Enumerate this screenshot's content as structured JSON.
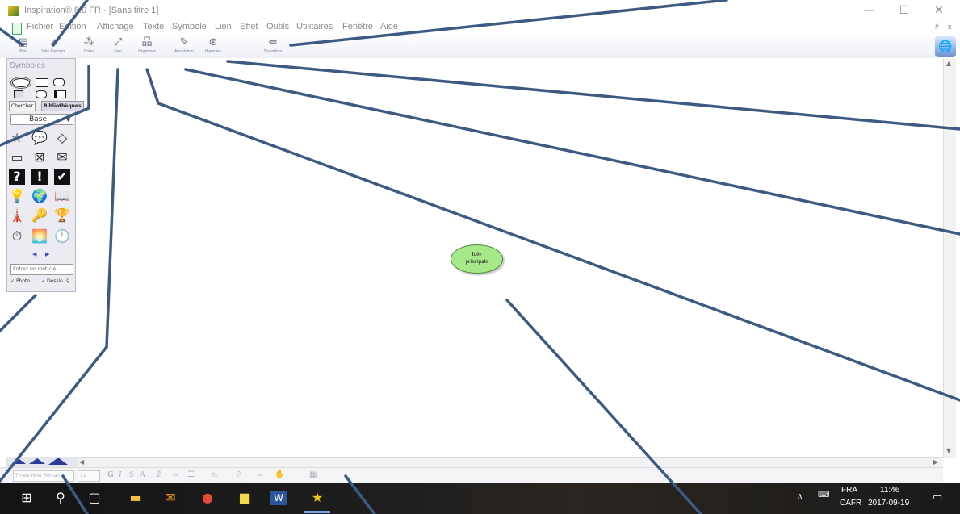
{
  "window": {
    "title": "Inspiration® 8.0 FR - [Sans titre 1]",
    "controls": {
      "minimize": "—",
      "maximize": "☐",
      "close": "✕"
    },
    "doc_controls": {
      "minimize": "-",
      "restore": "#",
      "close": "x"
    }
  },
  "menu": {
    "items": [
      "Fichier",
      "Edition",
      "Affichage",
      "Texte",
      "Symbole",
      "Lien",
      "Effet",
      "Outils",
      "Utilitaires",
      "Fenêtre",
      "Aide"
    ]
  },
  "toolbar": {
    "buttons": [
      {
        "label": "Plan",
        "icon": "outline-view-icon",
        "glyph": "▤"
      },
      {
        "label": "Idée Express",
        "icon": "rapidfire-icon",
        "glyph": "➚"
      },
      {
        "label": "Créer",
        "icon": "create-icon",
        "glyph": "⁂"
      },
      {
        "label": "Lien",
        "icon": "link-icon",
        "glyph": "⤢"
      },
      {
        "label": "Organiser",
        "icon": "arrange-icon",
        "glyph": "品"
      },
      {
        "label": "Annotation",
        "icon": "note-icon",
        "glyph": "✎"
      },
      {
        "label": "Hyperlien",
        "icon": "hyperlink-icon",
        "glyph": "⊛"
      },
      {
        "label": "Transférer",
        "icon": "transfer-icon",
        "glyph": "⇚"
      }
    ]
  },
  "palette": {
    "title": "Symboles",
    "tabs": {
      "search": "Chercher",
      "libraries": "Bibliothèques"
    },
    "library_selected": "Base",
    "search_placeholder": "Entrez un mot-clé...",
    "photo_label": "Photo",
    "drawing_label": "Dessin",
    "symbols": [
      {
        "icon": "star-shape-icon",
        "glyph": "☆"
      },
      {
        "icon": "speech-bubble-icon",
        "glyph": "💬"
      },
      {
        "icon": "diamond-shape-icon",
        "glyph": "◇"
      },
      {
        "icon": "rectangle-shape-icon",
        "glyph": "▭"
      },
      {
        "icon": "crossed-box-icon",
        "glyph": "⊠"
      },
      {
        "icon": "envelope-icon",
        "glyph": "✉"
      },
      {
        "icon": "question-mark-icon",
        "glyph": "?"
      },
      {
        "icon": "exclamation-icon",
        "glyph": "!"
      },
      {
        "icon": "checkmark-icon",
        "glyph": "✔"
      },
      {
        "icon": "lightbulb-icon",
        "glyph": "💡"
      },
      {
        "icon": "earth-icon",
        "glyph": "🌍"
      },
      {
        "icon": "book-icon",
        "glyph": "📖"
      },
      {
        "icon": "lighthouse-icon",
        "glyph": "🗼"
      },
      {
        "icon": "key-icon",
        "glyph": "🔑"
      },
      {
        "icon": "trophy-icon",
        "glyph": "🏆"
      },
      {
        "icon": "stopwatch-icon",
        "glyph": "⏱"
      },
      {
        "icon": "sunset-icon",
        "glyph": "🌅"
      },
      {
        "icon": "clock-icon",
        "glyph": "🕒"
      }
    ]
  },
  "canvas": {
    "main_idea_line1": "Idée",
    "main_idea_line2": "principale"
  },
  "format_bar": {
    "font": "Times New Roman",
    "size": "12",
    "bold": "G",
    "italic": "I",
    "underline": "S",
    "color": "A"
  },
  "taskbar": {
    "language": "FRA",
    "keyboard": "CAFR",
    "time": "11:46",
    "date": "2017-09-19"
  }
}
